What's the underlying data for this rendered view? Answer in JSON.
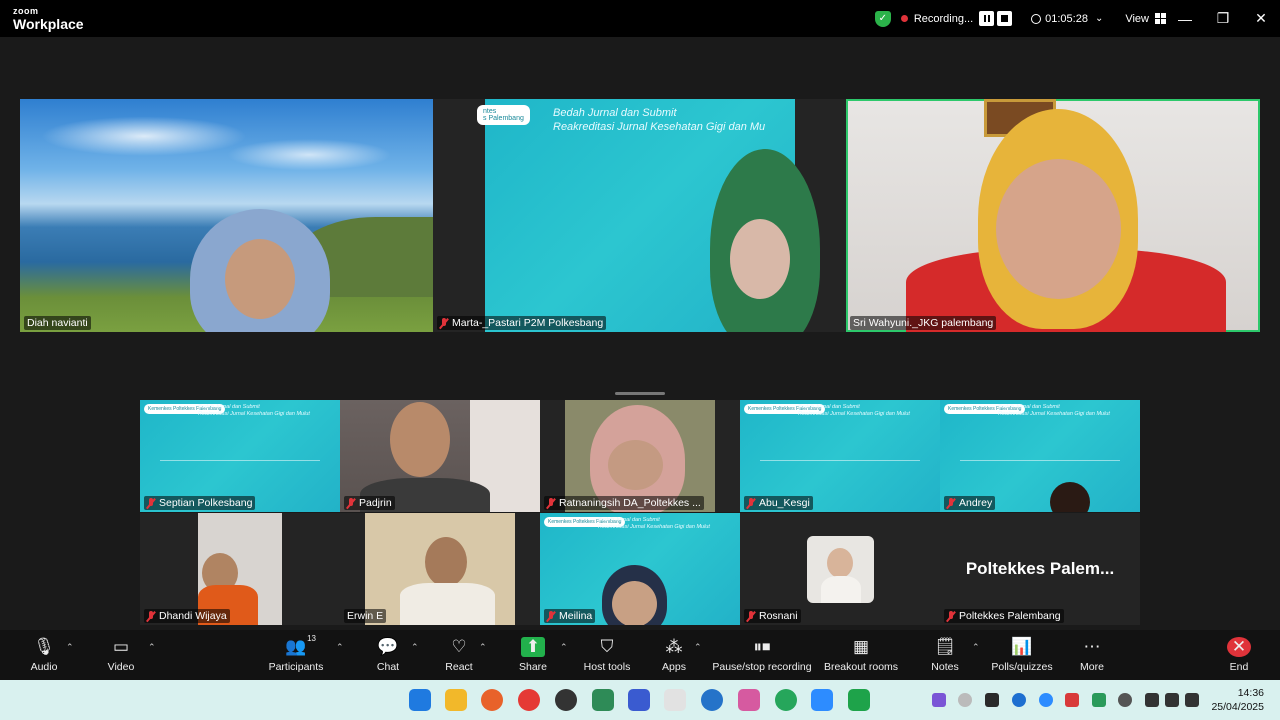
{
  "app": {
    "logo_top": "zoom",
    "logo_bottom": "Workplace"
  },
  "titlebar": {
    "recording_label": "Recording...",
    "elapsed": "01:05:28",
    "view_label": "View",
    "minimize_glyph": "—",
    "restore_glyph": "❐",
    "close_glyph": "✕"
  },
  "participants_top": [
    {
      "name": "Diah navianti",
      "muted": false
    },
    {
      "name": "Marta-_Pastari P2M Polkesbang",
      "muted": true
    },
    {
      "name": "Sri Wahyuni._JKG palembang",
      "muted": false,
      "active_speaker": true
    }
  ],
  "participants_gallery": [
    {
      "name": "Septian Polkesbang",
      "muted": true
    },
    {
      "name": "Padjrin",
      "muted": true
    },
    {
      "name": "Ratnaningsih DA_Poltekkes ...",
      "muted": true
    },
    {
      "name": "Abu_Kesgi",
      "muted": true
    },
    {
      "name": "Andrey",
      "muted": true
    },
    {
      "name": "Dhandi Wijaya",
      "muted": true
    },
    {
      "name": "Erwin E",
      "muted": false
    },
    {
      "name": "Meilina",
      "muted": true
    },
    {
      "name": "Rosnani",
      "muted": true
    },
    {
      "name": "Poltekkes Palembang",
      "muted": true,
      "display_text": "Poltekkes  Palem..."
    }
  ],
  "slide": {
    "title_line1": "Bedah Jurnal dan Submit",
    "title_line2": "Reakreditasi Jurnal Kesehatan Gigi dan Mu",
    "title_line2_full": "Reakreditasi Jurnal Kesehatan Gigi dan Mulut",
    "logo_text": "Kemenkes Poltekkes Palembang",
    "logo_partial": "ntes",
    "logo_partial2": "s Palembang"
  },
  "toolbar": {
    "audio": "Audio",
    "video": "Video",
    "participants": "Participants",
    "participants_count": "13",
    "chat": "Chat",
    "react": "React",
    "share": "Share",
    "host_tools": "Host tools",
    "apps": "Apps",
    "pause_stop_recording": "Pause/stop recording",
    "breakout_rooms": "Breakout rooms",
    "notes": "Notes",
    "polls_quizzes": "Polls/quizzes",
    "more": "More",
    "end": "End"
  },
  "taskbar": {
    "time": "14:36",
    "date": "25/04/2025"
  },
  "colors": {
    "active_speaker": "#2dc86b",
    "recording_dot": "#e0333a",
    "share_green": "#22b14c",
    "end_red": "#e0333a",
    "slide_teal": "#22b2c8"
  }
}
